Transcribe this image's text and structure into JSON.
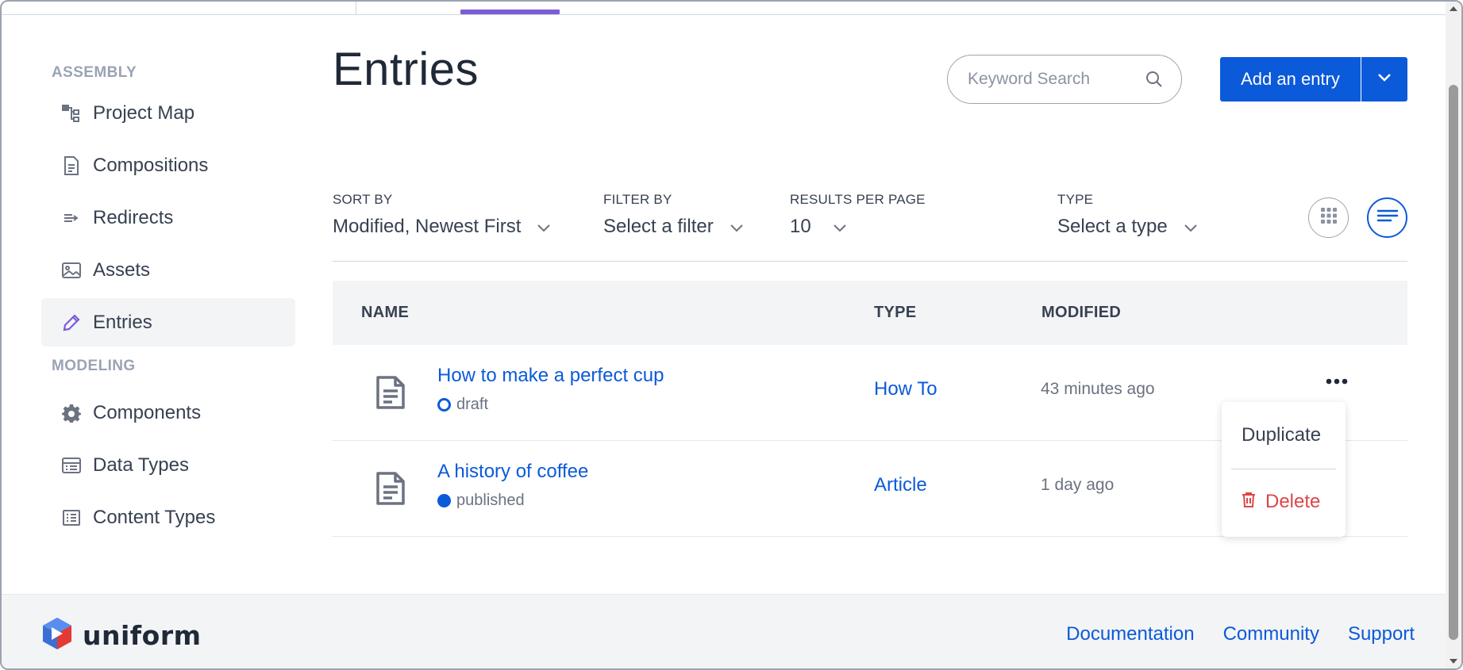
{
  "sidebar": {
    "assembly_title": "ASSEMBLY",
    "assembly_items": [
      {
        "label": "Project Map",
        "icon": "project-map-icon"
      },
      {
        "label": "Compositions",
        "icon": "compositions-icon"
      },
      {
        "label": "Redirects",
        "icon": "redirects-icon"
      },
      {
        "label": "Assets",
        "icon": "assets-icon"
      },
      {
        "label": "Entries",
        "icon": "entries-icon",
        "active": true
      }
    ],
    "modeling_title": "MODELING",
    "modeling_items": [
      {
        "label": "Components",
        "icon": "gear-icon"
      },
      {
        "label": "Data Types",
        "icon": "data-types-icon"
      },
      {
        "label": "Content Types",
        "icon": "content-types-icon"
      }
    ]
  },
  "main": {
    "title": "Entries",
    "search": {
      "placeholder": "Keyword Search"
    },
    "add_button": "Add an entry",
    "filters": {
      "sort_label": "SORT BY",
      "sort_value": "Modified, Newest First",
      "filter_label": "FILTER BY",
      "filter_value": "Select a filter",
      "results_label": "RESULTS PER PAGE",
      "results_value": "10",
      "type_label": "TYPE",
      "type_value": "Select a type"
    },
    "table": {
      "headers": {
        "name": "NAME",
        "type": "TYPE",
        "modified": "MODIFIED"
      },
      "rows": [
        {
          "name": "How to make a perfect cup",
          "status": "draft",
          "type": "How To",
          "modified": "43 minutes ago"
        },
        {
          "name": "A history of coffee",
          "status": "published",
          "type": "Article",
          "modified": "1 day ago"
        }
      ]
    },
    "row_menu": {
      "duplicate": "Duplicate",
      "delete": "Delete"
    }
  },
  "footer": {
    "brand": "uniform",
    "links": [
      "Documentation",
      "Community",
      "Support"
    ]
  },
  "colors": {
    "accent": "#0b5ad9",
    "active_tab": "#7c5cd6",
    "danger": "#dc4646"
  }
}
